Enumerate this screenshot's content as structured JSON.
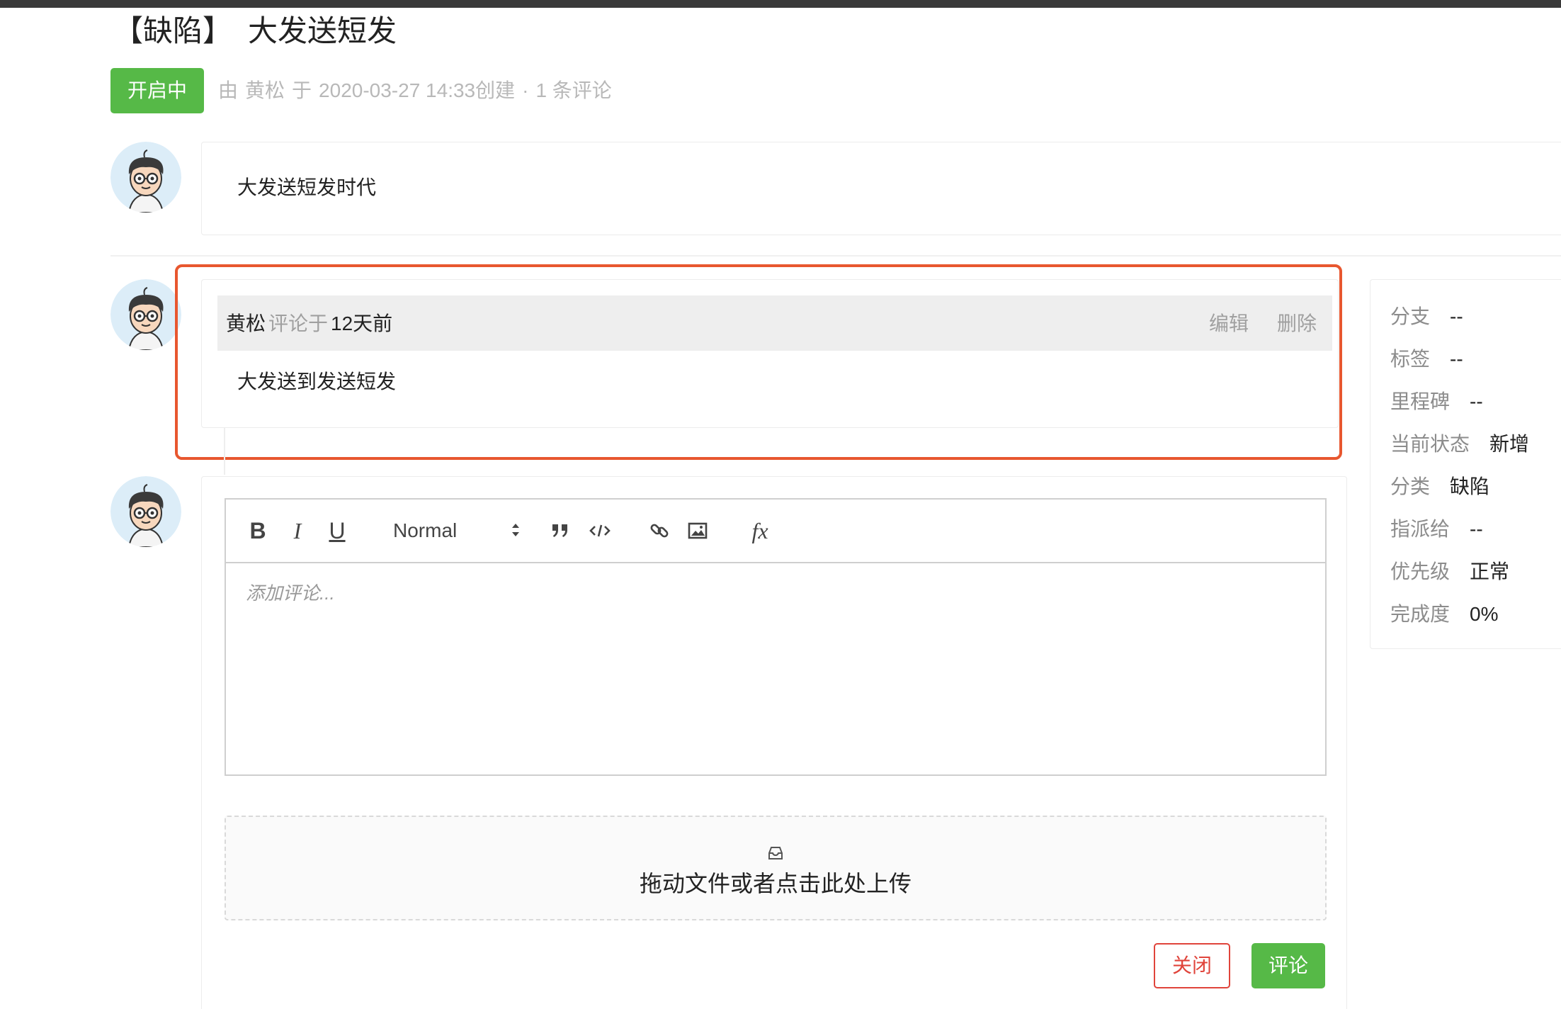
{
  "issue": {
    "tag": "【缺陷】",
    "title": "大发送短发",
    "status": "开启中",
    "meta": {
      "by": "由",
      "author": "黄松",
      "at": "于",
      "datetime": "2020-03-27 14:33创建",
      "dot": "·",
      "comment_count": "1 条评论"
    },
    "description": "大发送短发时代"
  },
  "comment": {
    "author": "黄松",
    "verb": "评论于",
    "time": "12天前",
    "edit_label": "编辑",
    "delete_label": "删除",
    "body": "大发送到发送短发"
  },
  "editor": {
    "bold": "B",
    "italic": "I",
    "underline": "U",
    "header_select": "Normal",
    "formula": "fx",
    "placeholder": "添加评论..."
  },
  "upload": {
    "text": "拖动文件或者点击此处上传"
  },
  "actions": {
    "close_label": "关闭",
    "comment_label": "评论"
  },
  "sidebar": {
    "rows": [
      {
        "label": "分支",
        "value": "--"
      },
      {
        "label": "标签",
        "value": "--"
      },
      {
        "label": "里程碑",
        "value": "--"
      },
      {
        "label": "当前状态",
        "value": "新增"
      },
      {
        "label": "分类",
        "value": "缺陷"
      },
      {
        "label": "指派给",
        "value": "--"
      },
      {
        "label": "优先级",
        "value": "正常"
      },
      {
        "label": "完成度",
        "value": "0%"
      }
    ]
  },
  "colors": {
    "accent_green": "#56b947",
    "danger_red": "#e0443b",
    "highlight_orange": "#e8572f"
  }
}
